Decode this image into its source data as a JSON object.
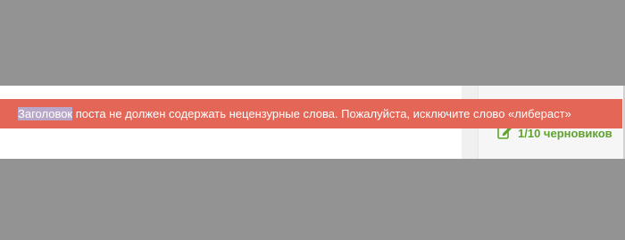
{
  "alert": {
    "highlighted_word": "Заголовок",
    "message_rest": " поста не должен содержать нецензурные слова. Пожалуйста, исключите слово «либераст»"
  },
  "drafts": {
    "icon": "edit-icon",
    "label": "1/10 черновиков"
  },
  "colors": {
    "overlay": "#939393",
    "alert_bg": "#e36657",
    "drafts_green": "#5fa32d",
    "highlight": "#b8a7c8"
  }
}
